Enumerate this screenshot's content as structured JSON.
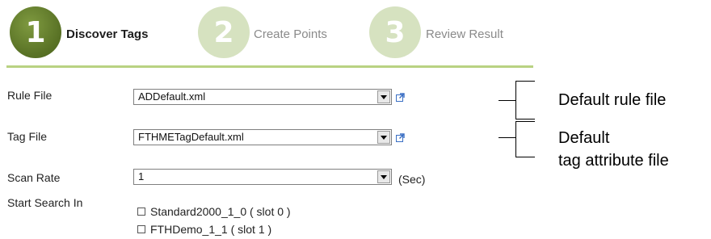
{
  "wizard": {
    "steps": [
      {
        "number": "1",
        "label": "Discover Tags",
        "state": "active"
      },
      {
        "number": "2",
        "label": "Create Points",
        "state": "inactive"
      },
      {
        "number": "3",
        "label": "Review Result",
        "state": "inactive"
      }
    ]
  },
  "form": {
    "rule_file": {
      "label": "Rule File",
      "value": "ADDefault.xml"
    },
    "tag_file": {
      "label": "Tag File",
      "value": "FTHMETagDefault.xml"
    },
    "scan_rate": {
      "label": "Scan Rate",
      "value": "1",
      "unit": "(Sec)"
    },
    "start_search": {
      "label": "Start Search In",
      "options": [
        {
          "label": "Standard2000_1_0 ( slot 0 )",
          "checked": false
        },
        {
          "label": "FTHDemo_1_1 ( slot 1 )",
          "checked": false
        }
      ]
    }
  },
  "annotations": {
    "rule_file_note": "Default rule file",
    "tag_file_note_line1": "Default",
    "tag_file_note_line2": "tag attribute file"
  },
  "colors": {
    "active_step": "#5a7326",
    "inactive_step": "#d6e2c0",
    "divider": "#b9d282"
  }
}
